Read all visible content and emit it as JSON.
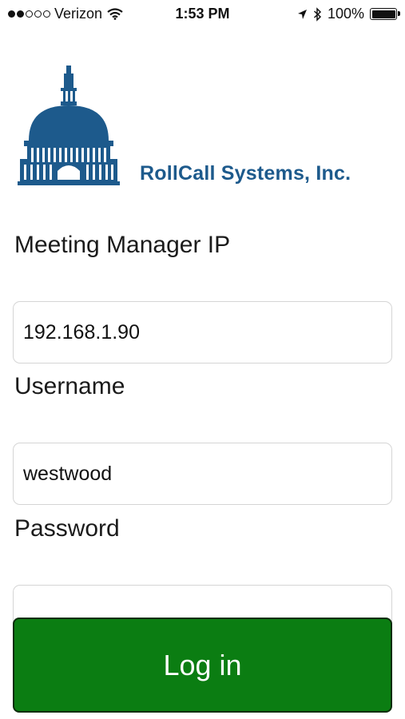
{
  "status_bar": {
    "carrier": "Verizon",
    "time": "1:53 PM",
    "battery": "100%",
    "signal_bars_filled": 2,
    "signal_bars_total": 5
  },
  "branding": {
    "company_name": "RollCall Systems, Inc.",
    "logo_icon": "capitol-dome-icon",
    "brand_color": "#1d5a8c"
  },
  "form": {
    "ip_label": "Meeting Manager IP",
    "ip_value": "192.168.1.90",
    "username_label": "Username",
    "username_value": "westwood",
    "password_label": "Password",
    "password_value": ""
  },
  "login_button": {
    "label": "Log in",
    "color": "#0b7d12"
  }
}
